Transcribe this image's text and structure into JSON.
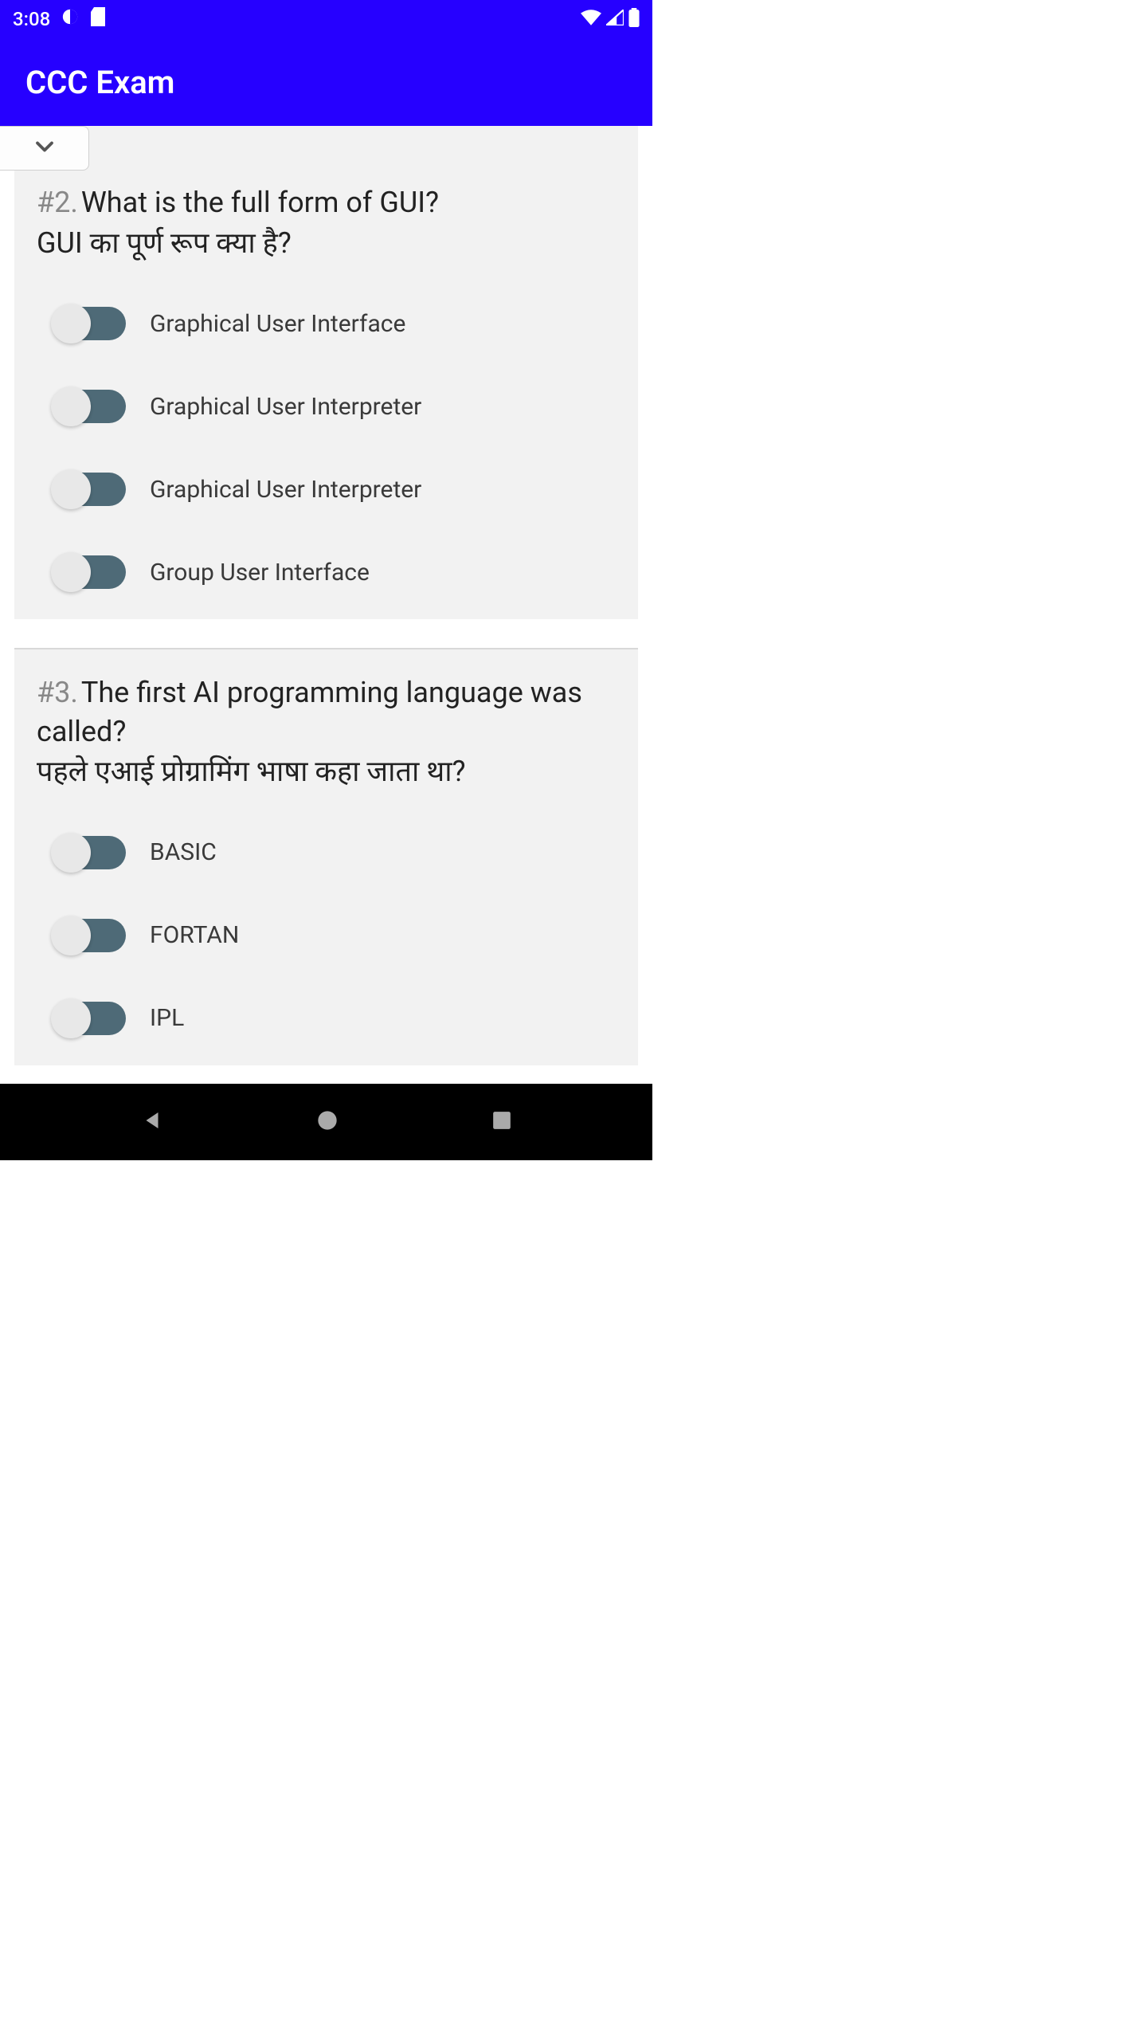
{
  "status": {
    "time": "3:08"
  },
  "app": {
    "title": "CCC Exam"
  },
  "questions": [
    {
      "num": "#2.",
      "text_en": "What is the full form of GUI?",
      "text_hi": "GUI का पूर्ण रूप क्या है?",
      "options": [
        "Graphical User Interface",
        "Graphical User Interpreter",
        "Graphical User Interpreter",
        "Group User Interface"
      ]
    },
    {
      "num": "#3.",
      "text_en": "The first AI programming language was called?",
      "text_hi": "पहले एआई प्रोग्रामिंग भाषा कहा जाता था?",
      "options": [
        "BASIC",
        "FORTAN",
        "IPL"
      ]
    }
  ]
}
